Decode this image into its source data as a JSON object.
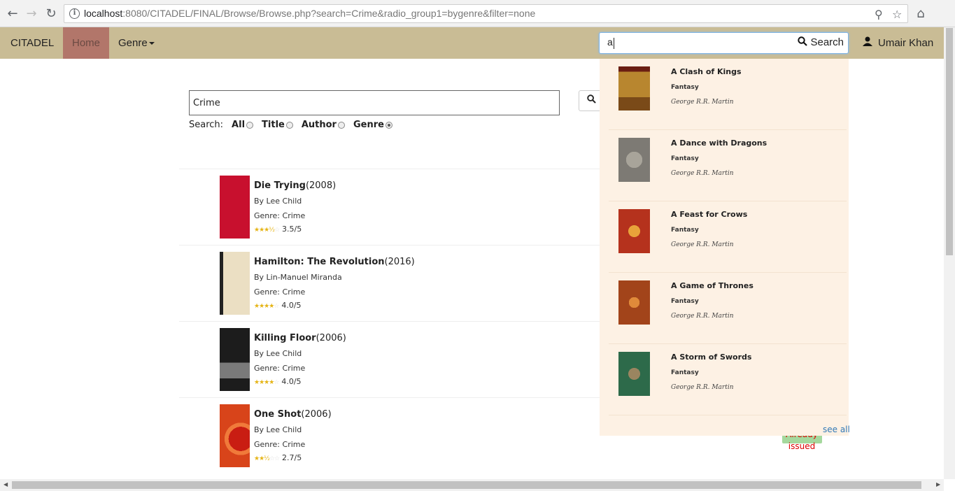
{
  "browser": {
    "url_host": "localhost",
    "url_rest": ":8080/CITADEL/FINAL/Browse/Browse.php?search=Crime&radio_group1=bygenre&filter=none"
  },
  "navbar": {
    "brand": "CITADEL",
    "home": "Home",
    "genre": "Genre",
    "search_value": "a",
    "search_button": "Search",
    "user": "Umair Khan"
  },
  "search": {
    "value": "Crime",
    "label": "Search:",
    "options": [
      "All",
      "Title",
      "Author",
      "Genre"
    ],
    "selected": "Genre"
  },
  "results": [
    {
      "title": "Die Trying",
      "year": "(2008)",
      "author": "By Lee Child",
      "genre": "Genre: Crime",
      "rating": "3.5/5",
      "stars_full": 3,
      "cover_color": "#c8102e"
    },
    {
      "title": "Hamilton: The Revolution",
      "year": "(2016)",
      "author": "By Lin-Manuel Miranda",
      "genre": "Genre: Crime",
      "rating": "4.0/5",
      "stars_full": 4,
      "cover_color": "#e8dcc0"
    },
    {
      "title": "Killing Floor",
      "year": "(2006)",
      "author": "By Lee Child",
      "genre": "Genre: Crime",
      "rating": "4.0/5",
      "stars_full": 4,
      "cover_color": "#1c1c1c"
    },
    {
      "title": "One Shot",
      "year": "(2006)",
      "author": "By Lee Child",
      "genre": "Genre: Crime",
      "rating": "2.7/5",
      "stars_full": 2,
      "cover_color": "#e04a16"
    }
  ],
  "status": {
    "already_issued": "Already issued"
  },
  "dropdown": {
    "items": [
      {
        "title": "A Clash of Kings",
        "genre": "Fantasy",
        "author": "George R.R. Martin",
        "cover_color": "#8a5a1f"
      },
      {
        "title": "A Dance with Dragons",
        "genre": "Fantasy",
        "author": "George R.R. Martin",
        "cover_color": "#7d7a74"
      },
      {
        "title": "A Feast for Crows",
        "genre": "Fantasy",
        "author": "George R.R. Martin",
        "cover_color": "#b5321d"
      },
      {
        "title": "A Game of Thrones",
        "genre": "Fantasy",
        "author": "George R.R. Martin",
        "cover_color": "#a2441a"
      },
      {
        "title": "A Storm of Swords",
        "genre": "Fantasy",
        "author": "George R.R. Martin",
        "cover_color": "#2d6a4a"
      }
    ],
    "see_all": "see all"
  }
}
